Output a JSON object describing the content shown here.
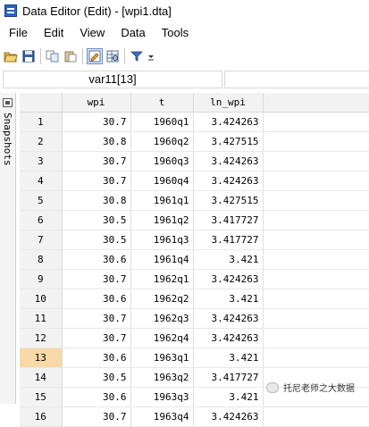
{
  "window": {
    "title": "Data Editor (Edit) - [wpi1.dta]"
  },
  "menu": [
    "File",
    "Edit",
    "View",
    "Data",
    "Tools"
  ],
  "toolbar_icons": [
    "open-icon",
    "save-icon",
    "copy-icon",
    "paste-icon",
    "edit-mode-icon",
    "browse-mode-icon",
    "filter-icon",
    "dropdown-arrow-icon"
  ],
  "cell_reference": "var11[13]",
  "snapshots": {
    "label": "Snapshots"
  },
  "grid": {
    "columns": [
      "wpi",
      "t",
      "ln_wpi"
    ],
    "selected_row": 13,
    "rows": [
      {
        "n": "1",
        "wpi": "30.7",
        "t": "1960q1",
        "ln_wpi": "3.424263"
      },
      {
        "n": "2",
        "wpi": "30.8",
        "t": "1960q2",
        "ln_wpi": "3.427515"
      },
      {
        "n": "3",
        "wpi": "30.7",
        "t": "1960q3",
        "ln_wpi": "3.424263"
      },
      {
        "n": "4",
        "wpi": "30.7",
        "t": "1960q4",
        "ln_wpi": "3.424263"
      },
      {
        "n": "5",
        "wpi": "30.8",
        "t": "1961q1",
        "ln_wpi": "3.427515"
      },
      {
        "n": "6",
        "wpi": "30.5",
        "t": "1961q2",
        "ln_wpi": "3.417727"
      },
      {
        "n": "7",
        "wpi": "30.5",
        "t": "1961q3",
        "ln_wpi": "3.417727"
      },
      {
        "n": "8",
        "wpi": "30.6",
        "t": "1961q4",
        "ln_wpi": "3.421"
      },
      {
        "n": "9",
        "wpi": "30.7",
        "t": "1962q1",
        "ln_wpi": "3.424263"
      },
      {
        "n": "10",
        "wpi": "30.6",
        "t": "1962q2",
        "ln_wpi": "3.421"
      },
      {
        "n": "11",
        "wpi": "30.7",
        "t": "1962q3",
        "ln_wpi": "3.424263"
      },
      {
        "n": "12",
        "wpi": "30.7",
        "t": "1962q4",
        "ln_wpi": "3.424263"
      },
      {
        "n": "13",
        "wpi": "30.6",
        "t": "1963q1",
        "ln_wpi": "3.421"
      },
      {
        "n": "14",
        "wpi": "30.5",
        "t": "1963q2",
        "ln_wpi": "3.417727"
      },
      {
        "n": "15",
        "wpi": "30.6",
        "t": "1963q3",
        "ln_wpi": "3.421"
      },
      {
        "n": "16",
        "wpi": "30.7",
        "t": "1963q4",
        "ln_wpi": "3.424263"
      }
    ]
  },
  "watermark": {
    "text": "托尼老师之大数据"
  },
  "colors": {
    "selected_row_header": "#f8d9a7",
    "header_bg": "#f2f2f2"
  }
}
